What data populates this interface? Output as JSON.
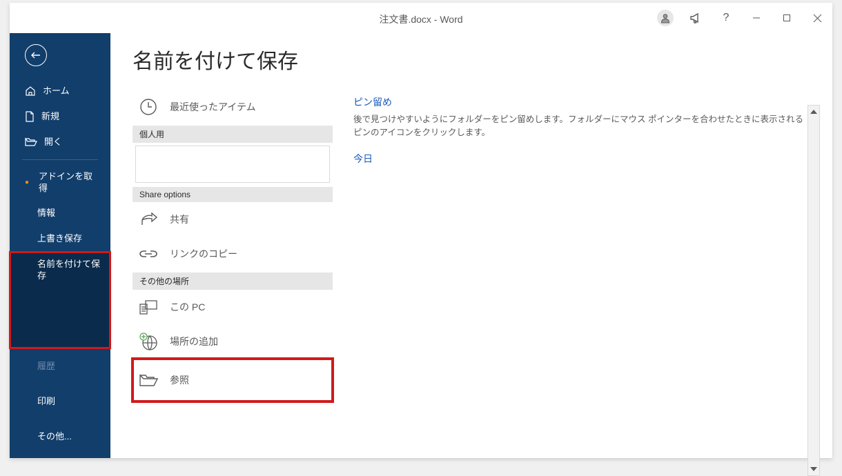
{
  "title": "注文書.docx  -  Word",
  "sidebar": {
    "home": "ホーム",
    "new": "新規",
    "open": "開く",
    "getaddins": "アドインを取得",
    "info": "情報",
    "save": "上書き保存",
    "saveas": "名前を付けて保存",
    "history": "履歴",
    "print": "印刷",
    "others": "その他..."
  },
  "page_title": "名前を付けて保存",
  "sources": {
    "recent": "最近使ったアイテム",
    "personal_header": "個人用",
    "share_header": "Share options",
    "share": "共有",
    "copy_link": "リンクのコピー",
    "other_header": "その他の場所",
    "this_pc": "この PC",
    "add_place": "場所の追加",
    "browse": "参照"
  },
  "right": {
    "pin_header": "ピン留め",
    "pin_desc": "後で見つけやすいようにフォルダーをピン留めします。フォルダーにマウス ポインターを合わせたときに表示されるピンのアイコンをクリックします。",
    "today": "今日"
  }
}
